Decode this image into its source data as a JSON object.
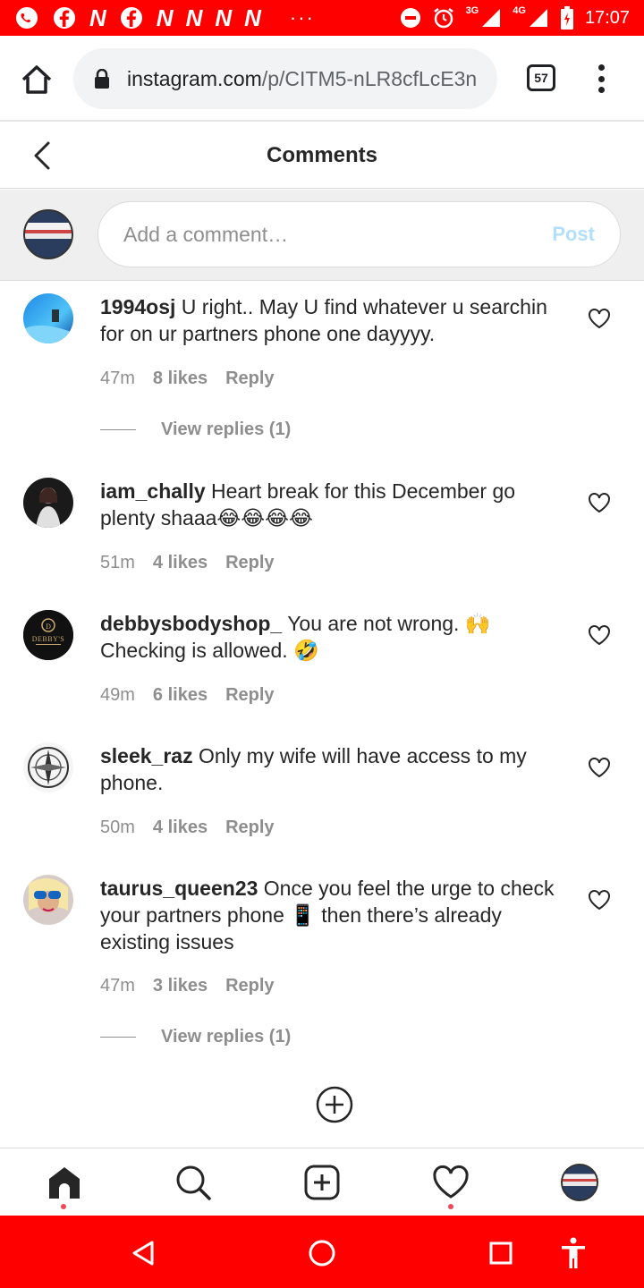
{
  "status_bar": {
    "left_icons": [
      "whatsapp-icon",
      "facebook-icon",
      "n-icon",
      "facebook-icon",
      "n-icon",
      "n-icon",
      "n-icon",
      "n-icon"
    ],
    "letter": "N",
    "dots": "···",
    "net_3g": "3G",
    "net_4g": "4G",
    "time": "17:07"
  },
  "browser": {
    "url_domain": "instagram.com",
    "url_path": "/p/CITM5-nLR8cfLcE3n",
    "tab_count": "57"
  },
  "header": {
    "title": "Comments"
  },
  "composer": {
    "placeholder": "Add a comment…",
    "post_label": "Post"
  },
  "comments": [
    {
      "username": "1994osj",
      "text": "U right.. May U find whatever u searchin for on ur partners phone one dayyyy.",
      "time": "47m",
      "likes": "8 likes",
      "reply": "Reply",
      "view_replies": "View replies (1)"
    },
    {
      "username": "iam_chally",
      "text": "Heart break for this December go plenty shaaa😂😂😂😂",
      "time": "51m",
      "likes": "4 likes",
      "reply": "Reply"
    },
    {
      "username": "debbysbodyshop_",
      "text": "You are not wrong. 🙌 Checking is allowed. 🤣",
      "time": "49m",
      "likes": "6 likes",
      "reply": "Reply",
      "avatar_text": "DEBBY'S"
    },
    {
      "username": "sleek_raz",
      "text": "Only my wife will have access to my phone.",
      "time": "50m",
      "likes": "4 likes",
      "reply": "Reply"
    },
    {
      "username": "taurus_queen23",
      "text": "Once you feel the urge to check your partners phone 📱 then there’s already existing issues",
      "time": "47m",
      "likes": "3 likes",
      "reply": "Reply",
      "view_replies": "View replies (1)"
    }
  ],
  "ig_nav": [
    "home-icon",
    "search-icon",
    "new-post-icon",
    "activity-icon",
    "profile-avatar"
  ],
  "colors": {
    "status_bar": "#ff0000",
    "post_button": "#b2dffc",
    "meta_text": "#8e8e8e",
    "notification_dot": "#ed4956"
  }
}
